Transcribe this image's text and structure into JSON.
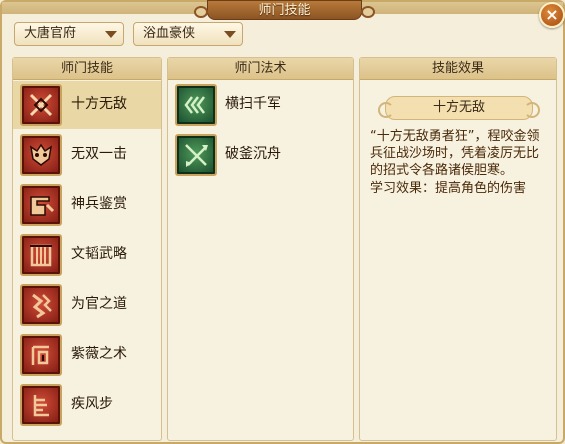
{
  "window": {
    "title": "师门技能",
    "close_symbol": "×"
  },
  "filters": {
    "school": {
      "selected": "大唐官府"
    },
    "class": {
      "selected": "浴血豪侠"
    }
  },
  "skills_panel": {
    "header": "师门技能",
    "items": [
      {
        "label": "十方无敌",
        "icon": "crossed-blades-icon",
        "selected": true
      },
      {
        "label": "无双一击",
        "icon": "beast-mask-icon",
        "selected": false
      },
      {
        "label": "神兵鉴赏",
        "icon": "forge-icon",
        "selected": false
      },
      {
        "label": "文韬武略",
        "icon": "scroll-gate-icon",
        "selected": false
      },
      {
        "label": "为官之道",
        "icon": "official-seal-icon",
        "selected": false
      },
      {
        "label": "紫薇之术",
        "icon": "star-rune-icon",
        "selected": false
      },
      {
        "label": "疾风步",
        "icon": "wind-step-icon",
        "selected": false
      }
    ]
  },
  "spells_panel": {
    "header": "师门法术",
    "items": [
      {
        "label": "横扫千军",
        "icon": "triple-chevron-icon"
      },
      {
        "label": "破釜沉舟",
        "icon": "crossed-spears-icon"
      }
    ]
  },
  "effect_panel": {
    "header": "技能效果",
    "name": "十方无敌",
    "description": "“十方无敌勇者狂”，程咬金领兵征战沙场时，凭着凌厉无比的招式令各路诸侯胆寒。",
    "learn_effect": "学习效果：提高角色的伤害"
  },
  "colors": {
    "panel_bg": "#f7f1e0",
    "header_bg": "#dcc28a",
    "selected_row": "#e9d8a6",
    "skill_icon": "#b12e1f",
    "spell_icon": "#2f6e3d",
    "close_button": "#c2651f"
  }
}
